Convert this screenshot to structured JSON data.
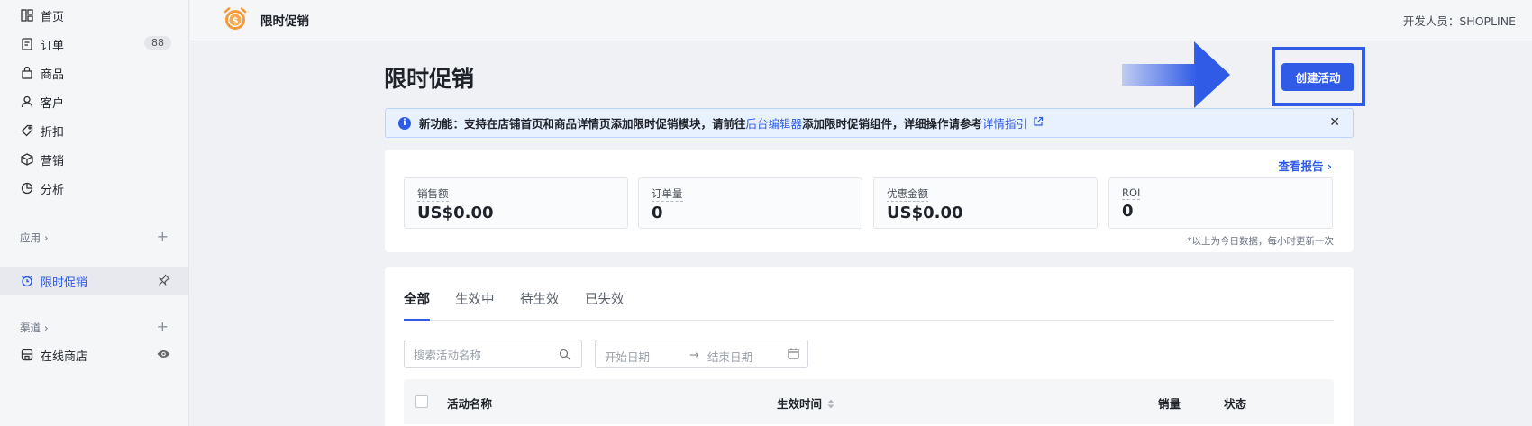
{
  "sidebar": {
    "items": [
      {
        "label": "首页",
        "icon": "dashboard-icon"
      },
      {
        "label": "订单",
        "icon": "order-icon",
        "badge": "88"
      },
      {
        "label": "商品",
        "icon": "bag-icon"
      },
      {
        "label": "客户",
        "icon": "user-icon"
      },
      {
        "label": "折扣",
        "icon": "tag-icon"
      },
      {
        "label": "营销",
        "icon": "box-icon"
      },
      {
        "label": "分析",
        "icon": "pie-icon"
      }
    ],
    "apps_section": "应用",
    "active_app": "限时促销",
    "channels_section": "渠道",
    "online_store": "在线商店"
  },
  "topbar": {
    "app_title": "限时促销",
    "developer": "开发人员：SHOPLINE"
  },
  "main": {
    "page_title": "限时促销",
    "create_button": "创建活动",
    "notice": {
      "prefix": "新功能：支持在店铺首页和商品详情页添加限时促销模块，请前往",
      "link1": "后台编辑器",
      "middle": "添加限时促销组件，详细操作请参考",
      "link2": "详情指引"
    },
    "report_link": "查看报告",
    "stats": [
      {
        "label": "销售额",
        "value": "US$0.00"
      },
      {
        "label": "订单量",
        "value": "0"
      },
      {
        "label": "优惠金额",
        "value": "US$0.00"
      },
      {
        "label": "ROI",
        "value": "0"
      }
    ],
    "stats_note": "*以上为今日数据，每小时更新一次",
    "tabs": [
      "全部",
      "生效中",
      "待生效",
      "已失效"
    ],
    "search_placeholder": "搜索活动名称",
    "date_start": "开始日期",
    "date_end": "结束日期",
    "columns": [
      "活动名称",
      "生效时间",
      "销量",
      "状态"
    ]
  },
  "colors": {
    "accent": "#2f5be7",
    "notice_bg": "#e8f1ff"
  }
}
